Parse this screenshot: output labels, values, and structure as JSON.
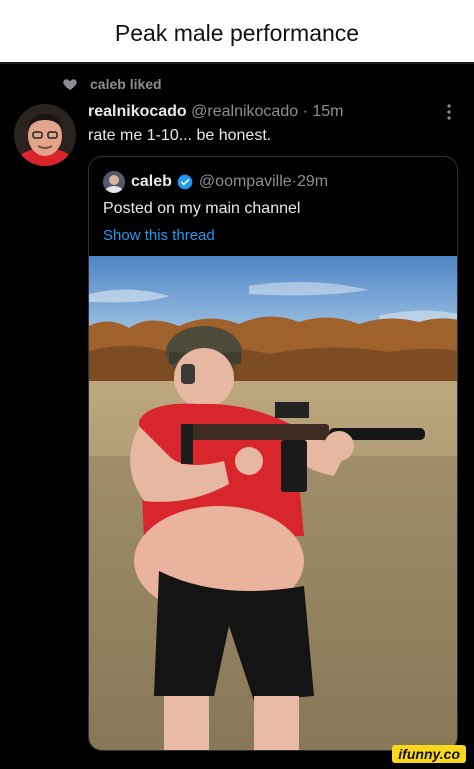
{
  "meme": {
    "caption": "Peak male performance"
  },
  "activity": {
    "liked_label": "caleb liked"
  },
  "tweet": {
    "name": "realnikocado",
    "handle": "@realnikocado",
    "separator": "·",
    "time": "15m",
    "text": "rate me 1-10... be honest."
  },
  "quoted": {
    "name": "caleb",
    "handle": "@oompaville",
    "separator": "·",
    "time": "29m",
    "text": "Posted on my main channel",
    "show_thread_label": "Show this thread"
  },
  "watermark": {
    "text": "ifunny.co"
  },
  "icons": {
    "heart": "heart-icon",
    "verified": "verified-badge-icon",
    "more": "more-options-icon"
  },
  "colors": {
    "background": "#000000",
    "caption_bg": "#ffffff",
    "link": "#1d9bf0",
    "verified": "#1d9bf0",
    "muted": "#8b8f94",
    "watermark_bg": "#f9d71c"
  }
}
